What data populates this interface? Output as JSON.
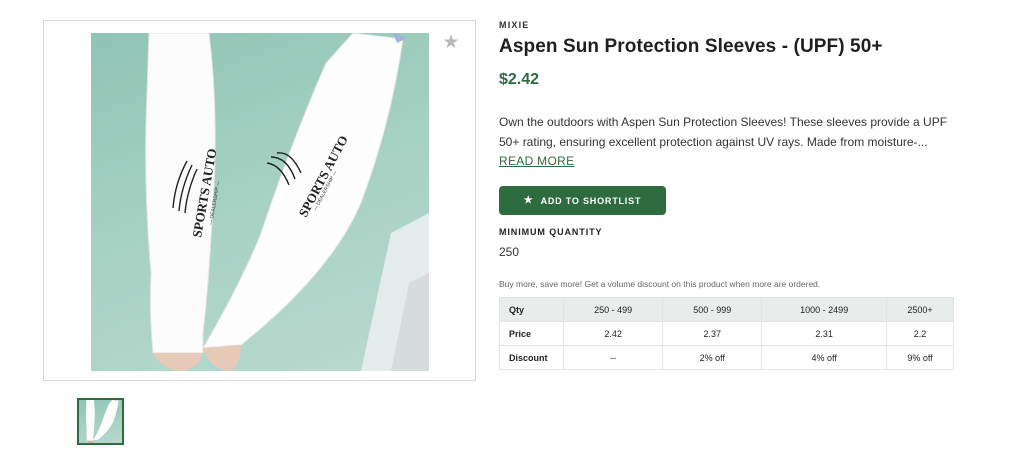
{
  "product": {
    "brand": "MIXIE",
    "title": "Aspen Sun Protection Sleeves - (UPF) 50+",
    "price": "$2.42",
    "description": "Own the outdoors with Aspen Sun Protection Sleeves! These sleeves provide a UPF 50+ rating, ensuring excellent protection against UV rays. Made from moisture-...",
    "read_more_label": "READ MORE",
    "shortlist_label": "ADD TO SHORTLIST",
    "min_quantity_label": "MINIMUM QUANTITY",
    "min_quantity_value": "250",
    "volume_note": "Buy more, save more! Get a volume discount on this product when more are ordered."
  },
  "image": {
    "sleeve_print_text": "SPORTS AUTO",
    "sleeve_print_subtext": "— DEALERSHIP —",
    "favorite_icon": "star-icon"
  },
  "pricing_table": {
    "headers": [
      "Qty",
      "250 - 499",
      "500 - 999",
      "1000 - 2499",
      "2500+"
    ],
    "rows": [
      [
        "Price",
        "2.42",
        "2.37",
        "2.31",
        "2.2"
      ],
      [
        "Discount",
        "--",
        "2% off",
        "4% off",
        "9% off"
      ]
    ]
  },
  "colors": {
    "accent": "#2e6b3f",
    "photo_background": "#a5d0c2",
    "table_header": "#e8ecea"
  }
}
